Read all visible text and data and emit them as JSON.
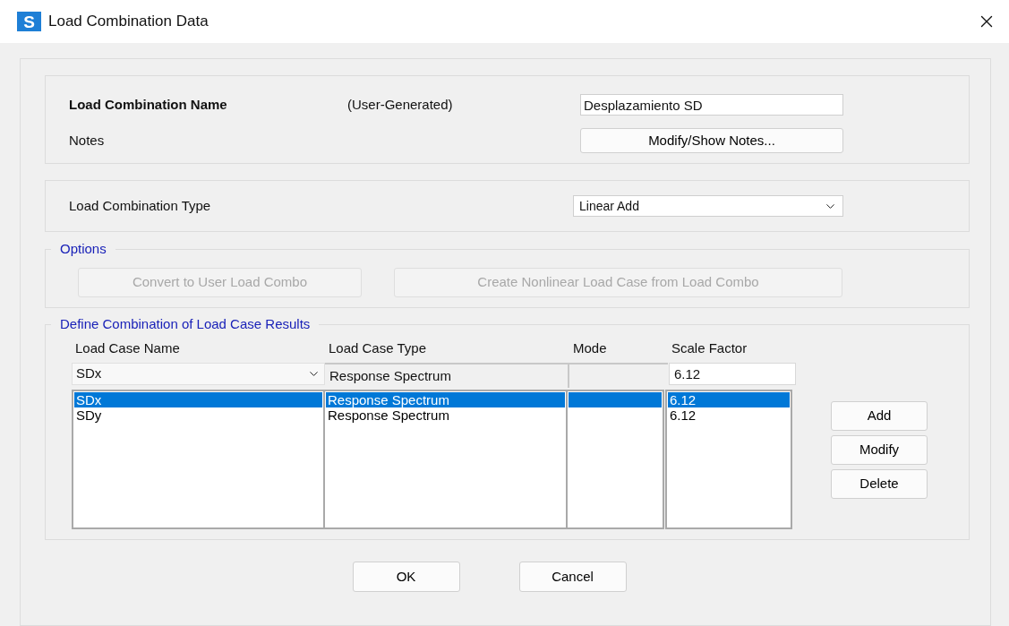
{
  "window": {
    "app_icon_letter": "S",
    "title": "Load Combination Data"
  },
  "name_section": {
    "name_label": "Load Combination Name",
    "origin": "(User-Generated)",
    "name_value": "Desplazamiento SD",
    "notes_label": "Notes",
    "notes_button": "Modify/Show Notes..."
  },
  "type_section": {
    "label": "Load Combination Type",
    "value": "Linear Add"
  },
  "options": {
    "title": "Options",
    "buttons": [
      {
        "label": "Convert to User Load Combo",
        "disabled": true
      },
      {
        "label": "Create Nonlinear Load Case from Load Combo",
        "disabled": true
      }
    ]
  },
  "define": {
    "title": "Define Combination of Load Case Results",
    "columns": [
      "Load Case Name",
      "Load Case Type",
      "Mode",
      "Scale Factor"
    ],
    "editor": {
      "case_name": "SDx",
      "case_type": "Response Spectrum",
      "scale_factor": "6.12"
    },
    "rows": [
      {
        "name": "SDx",
        "type": "Response Spectrum",
        "scale_factor": "6.12",
        "selected": true
      },
      {
        "name": "SDy",
        "type": "Response Spectrum",
        "scale_factor": "6.12",
        "selected": false
      }
    ],
    "buttons": [
      "Add",
      "Modify",
      "Delete"
    ]
  },
  "footer_buttons": [
    "OK",
    "Cancel"
  ]
}
